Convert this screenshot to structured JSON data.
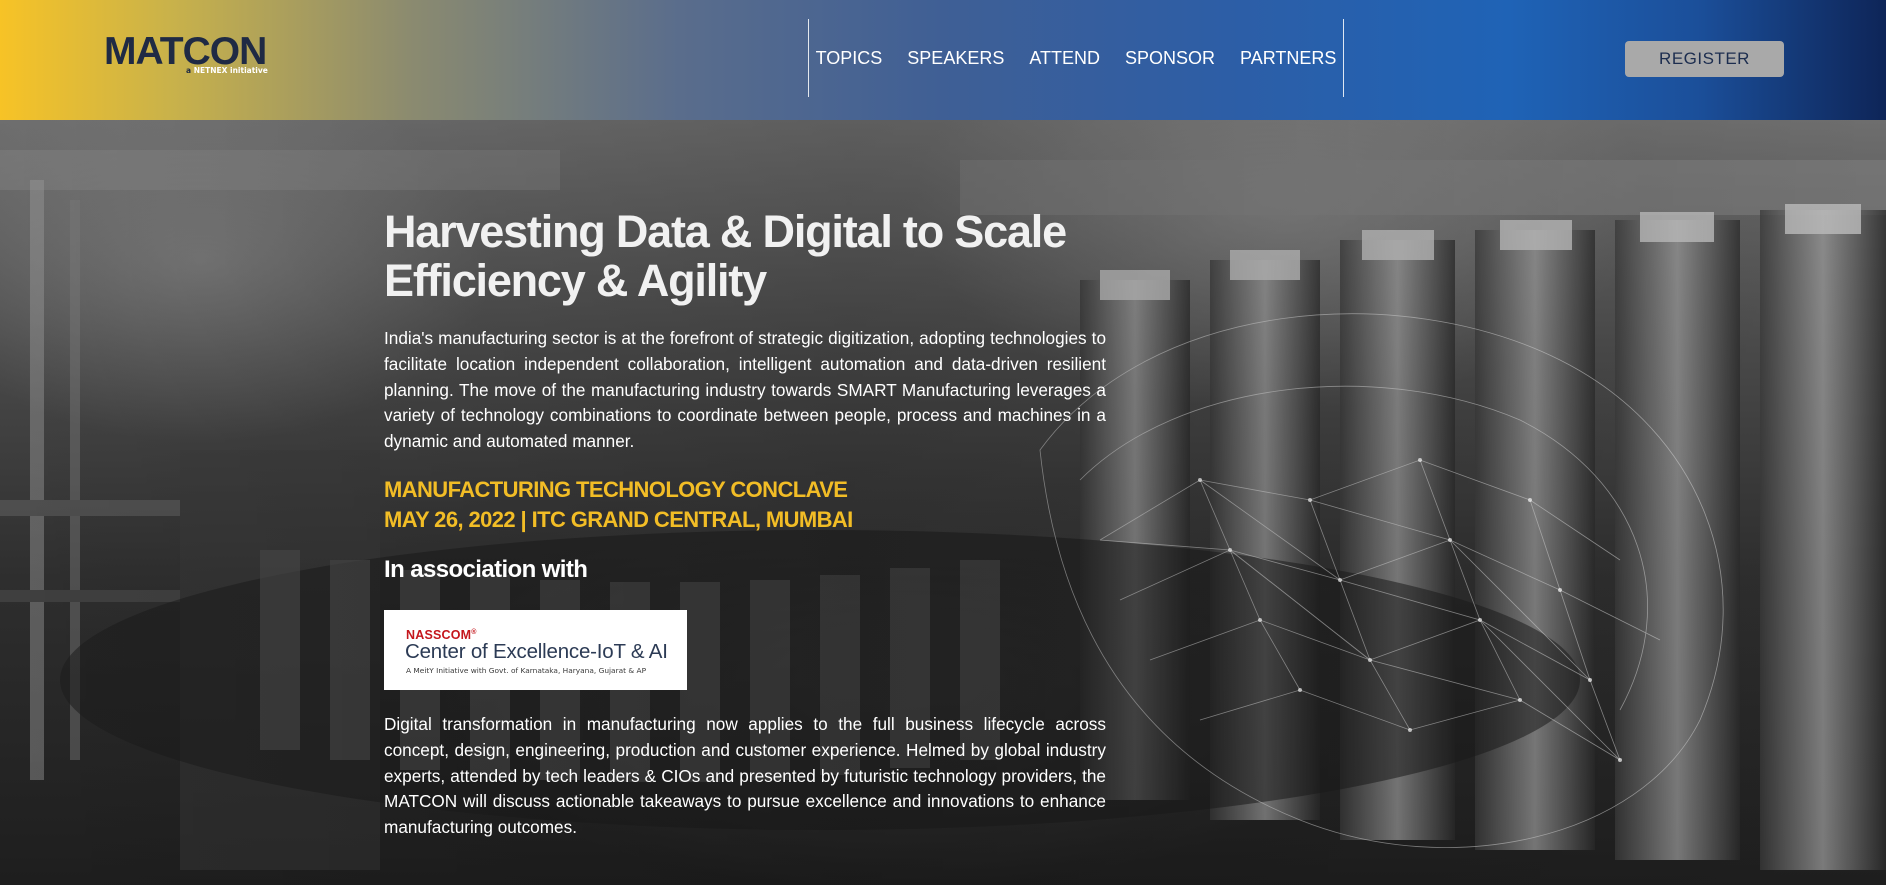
{
  "header": {
    "logo": {
      "name": "MATCON",
      "tagline_prefix": "a ",
      "tagline_brand": "NETNEX",
      "tagline_suffix": " initiative"
    },
    "nav": [
      "TOPICS",
      "SPEAKERS",
      "ATTEND",
      "SPONSOR",
      "PARTNERS"
    ],
    "register_label": "REGISTER"
  },
  "hero": {
    "headline_line1": "Harvesting Data & Digital to Scale",
    "headline_line2": "Efficiency & Agility",
    "intro": "India's manufacturing sector is at the forefront of strategic digitization, adopting technologies to facilitate location independent collaboration, intelligent automation and data-driven resilient planning. The move of the manufacturing industry towards SMART Manufacturing leverages a variety of technology combinations to coordinate between people, process and machines in a dynamic and automated manner.",
    "event_name": "MANUFACTURING TECHNOLOGY CONCLAVE",
    "event_details": "MAY 26, 2022 | ITC GRAND CENTRAL, MUMBAI",
    "association_heading": "In association with",
    "partner": {
      "brand": "NASSCOM",
      "brand_mark": "®",
      "title": "Center of Excellence-IoT & AI",
      "subtitle": "A MeitY Initiative with Govt. of Karnataka, Haryana, Gujarat & AP"
    },
    "outro": "Digital transformation in manufacturing now applies to the full business lifecycle across concept, design, engineering, production and customer experience. Helmed by global industry experts, attended by tech leaders & CIOs and presented by futuristic technology providers, the MATCON will discuss actionable takeaways to pursue excellence and innovations to enhance manufacturing outcomes."
  },
  "colors": {
    "accent_yellow": "#f2bd26",
    "header_blue": "#1f63b6",
    "header_navy": "#0e2558",
    "register_bg": "#a9a9a9",
    "nasscom_red": "#c4161c"
  }
}
